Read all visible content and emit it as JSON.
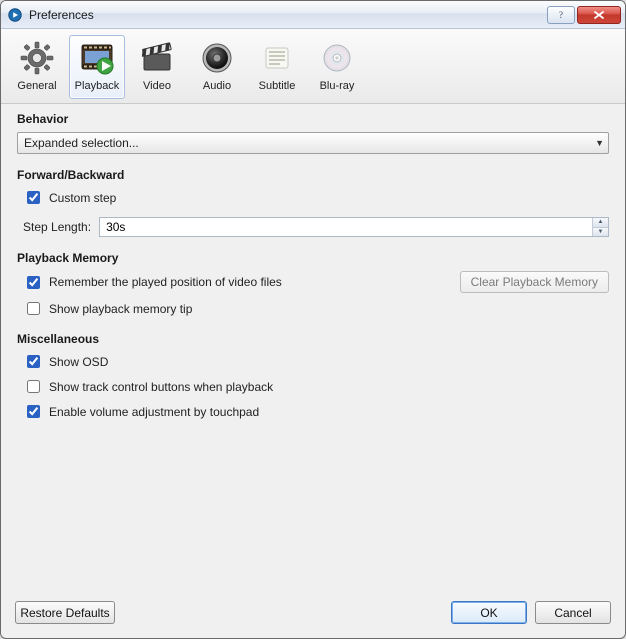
{
  "window": {
    "title": "Preferences"
  },
  "toolbar": {
    "items": [
      {
        "id": "general",
        "label": "General"
      },
      {
        "id": "playback",
        "label": "Playback"
      },
      {
        "id": "video",
        "label": "Video"
      },
      {
        "id": "audio",
        "label": "Audio"
      },
      {
        "id": "subtitle",
        "label": "Subtitle"
      },
      {
        "id": "bluray",
        "label": "Blu-ray"
      }
    ],
    "selected": "playback"
  },
  "sections": {
    "behavior": {
      "title": "Behavior",
      "selection": "Expanded selection..."
    },
    "fwdback": {
      "title": "Forward/Backward",
      "custom_step_label": "Custom step",
      "custom_step_checked": true,
      "step_length_label": "Step Length:",
      "step_length_value": "30s"
    },
    "memory": {
      "title": "Playback Memory",
      "remember_label": "Remember the played position of video files",
      "remember_checked": true,
      "clear_button": "Clear Playback Memory",
      "tip_label": "Show playback memory tip",
      "tip_checked": false
    },
    "misc": {
      "title": "Miscellaneous",
      "osd_label": "Show OSD",
      "osd_checked": true,
      "track_label": "Show track control buttons when playback",
      "track_checked": false,
      "touchpad_label": "Enable volume adjustment by touchpad",
      "touchpad_checked": true
    }
  },
  "footer": {
    "restore": "Restore Defaults",
    "ok": "OK",
    "cancel": "Cancel"
  }
}
